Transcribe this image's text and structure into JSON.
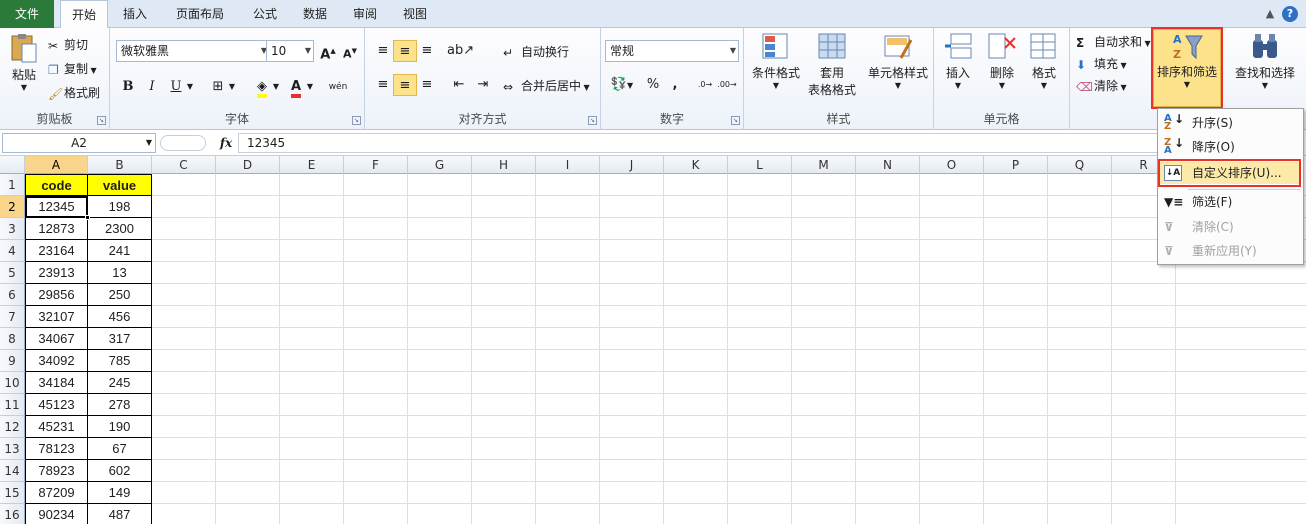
{
  "tabs": {
    "file": "文件",
    "home": "开始",
    "insert": "插入",
    "page_layout": "页面布局",
    "formulas": "公式",
    "data": "数据",
    "review": "审阅",
    "view": "视图"
  },
  "clipboard": {
    "label": "剪贴板",
    "paste": "粘贴",
    "cut": "剪切",
    "copy": "复制",
    "format_painter": "格式刷"
  },
  "font": {
    "label": "字体",
    "name": "微软雅黑",
    "size": "10",
    "bold": "B",
    "italic": "I",
    "underline": "U",
    "phonetic": "wén"
  },
  "alignment": {
    "label": "对齐方式",
    "wrap": "自动换行",
    "merge": "合并后居中"
  },
  "number": {
    "label": "数字",
    "format": "常规",
    "percent": "%",
    "comma": ","
  },
  "styles": {
    "label": "样式",
    "conditional": "条件格式",
    "table_format_1": "套用",
    "table_format_2": "表格格式",
    "cell_styles": "单元格样式"
  },
  "cells": {
    "label": "单元格",
    "insert": "插入",
    "delete": "删除",
    "format": "格式"
  },
  "editing": {
    "autosum": "自动求和",
    "fill": "填充",
    "clear": "清除",
    "sort_filter": "排序和筛选",
    "find_select": "查找和选择"
  },
  "formula_bar": {
    "name_box": "A2",
    "fx": "fx",
    "content": "12345"
  },
  "columns": [
    "A",
    "B",
    "C",
    "D",
    "E",
    "F",
    "G",
    "H",
    "I",
    "J",
    "K",
    "L",
    "M",
    "N",
    "O",
    "P",
    "Q",
    "R"
  ],
  "rows": [
    "1",
    "2",
    "3",
    "4",
    "5",
    "6",
    "7",
    "8",
    "9",
    "10",
    "11",
    "12",
    "13",
    "14",
    "15",
    "16"
  ],
  "table": {
    "headers": [
      "code",
      "value"
    ],
    "data": [
      [
        "12345",
        "198"
      ],
      [
        "12873",
        "2300"
      ],
      [
        "23164",
        "241"
      ],
      [
        "23913",
        "13"
      ],
      [
        "29856",
        "250"
      ],
      [
        "32107",
        "456"
      ],
      [
        "34067",
        "317"
      ],
      [
        "34092",
        "785"
      ],
      [
        "34184",
        "245"
      ],
      [
        "45123",
        "278"
      ],
      [
        "45231",
        "190"
      ],
      [
        "78123",
        "67"
      ],
      [
        "78923",
        "602"
      ],
      [
        "87209",
        "149"
      ],
      [
        "90234",
        "487"
      ]
    ]
  },
  "sort_menu": {
    "items": [
      {
        "label": "升序(S)",
        "enabled": true
      },
      {
        "label": "降序(O)",
        "enabled": true
      },
      {
        "label": "自定义排序(U)...",
        "enabled": true
      },
      {
        "label": "筛选(F)",
        "enabled": true
      },
      {
        "label": "清除(C)",
        "enabled": false
      },
      {
        "label": "重新应用(Y)",
        "enabled": false
      }
    ]
  },
  "colors": {
    "accent_red": "#e8312b",
    "header_yellow": "#ffff00",
    "selected_orange": "#fde28c",
    "file_tab": "#2a7a3a"
  }
}
